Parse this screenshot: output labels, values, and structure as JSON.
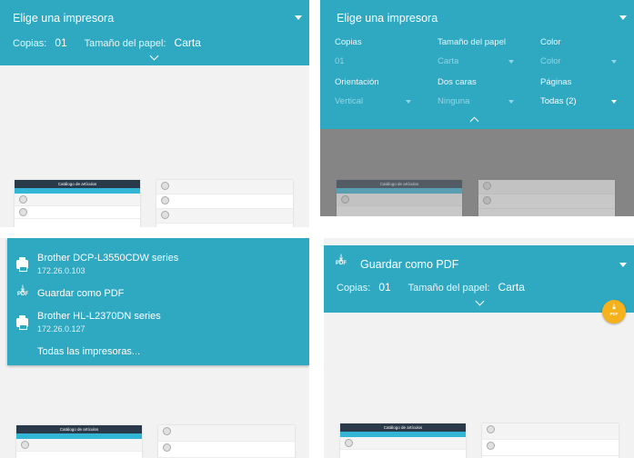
{
  "panel1": {
    "title": "Elige una impresora",
    "copies_label": "Copias:",
    "copies_value": "01",
    "paper_label": "Tamaño del papel:",
    "paper_value": "Carta"
  },
  "panel2": {
    "title": "Elige una impresora",
    "fields": [
      {
        "label": "Copias",
        "value": "01"
      },
      {
        "label": "Tamaño del papel",
        "value": "Carta"
      },
      {
        "label": "Color",
        "value": "Color"
      },
      {
        "label": "Orientación",
        "value": "Vertical"
      },
      {
        "label": "Dos caras",
        "value": "Ninguna"
      },
      {
        "label": "Páginas",
        "value": "Todas (2)"
      }
    ]
  },
  "panel3": {
    "printers": [
      {
        "name": "Brother DCP-L3550CDW series",
        "ip": "172.26.0.103"
      },
      {
        "name": "Guardar como PDF"
      },
      {
        "name": "Brother HL-L2370DN series",
        "ip": "172.26.0.127"
      }
    ],
    "all_printers": "Todas las impresoras..."
  },
  "panel4": {
    "title": "Guardar como PDF",
    "pdf_icon_label": "PDF",
    "copies_label": "Copias:",
    "copies_value": "01",
    "paper_label": "Tamaño del papel:",
    "paper_value": "Carta",
    "fab_label": "PDF"
  },
  "preview": {
    "catalog_title": "Catálogo de artículos"
  },
  "colors": {
    "bar": "#2fa8c2",
    "fab": "#f5b21c",
    "catalog_header": "#2b3a4a"
  }
}
